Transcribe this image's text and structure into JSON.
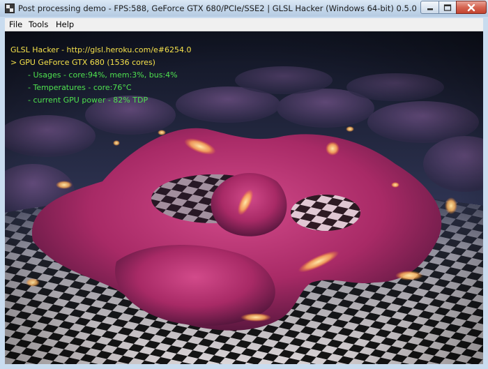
{
  "window": {
    "title": "Post processing demo - FPS:588, GeForce GTX 680/PCIe/SSE2 | GLSL Hacker (Windows 64-bit) 0.5.0"
  },
  "menu": {
    "items": [
      "File",
      "Tools",
      "Help"
    ]
  },
  "overlay": {
    "title": "GLSL Hacker - http://glsl.heroku.com/e#6254.0",
    "gpu": "> GPU GeForce GTX 680 (1536 cores)",
    "lines": [
      "- Usages - core:94%, mem:3%, bus:4%",
      "- Temperatures - core:76°C",
      "- current GPU power - 82% TDP"
    ]
  },
  "colors": {
    "overlay_title": "#f6e24b",
    "overlay_lines": "#4fe24f",
    "blob": "#b0306e",
    "titlebar": "#c3d6ea"
  },
  "icons": [
    "app-icon",
    "minimize-icon",
    "maximize-icon",
    "close-icon"
  ]
}
